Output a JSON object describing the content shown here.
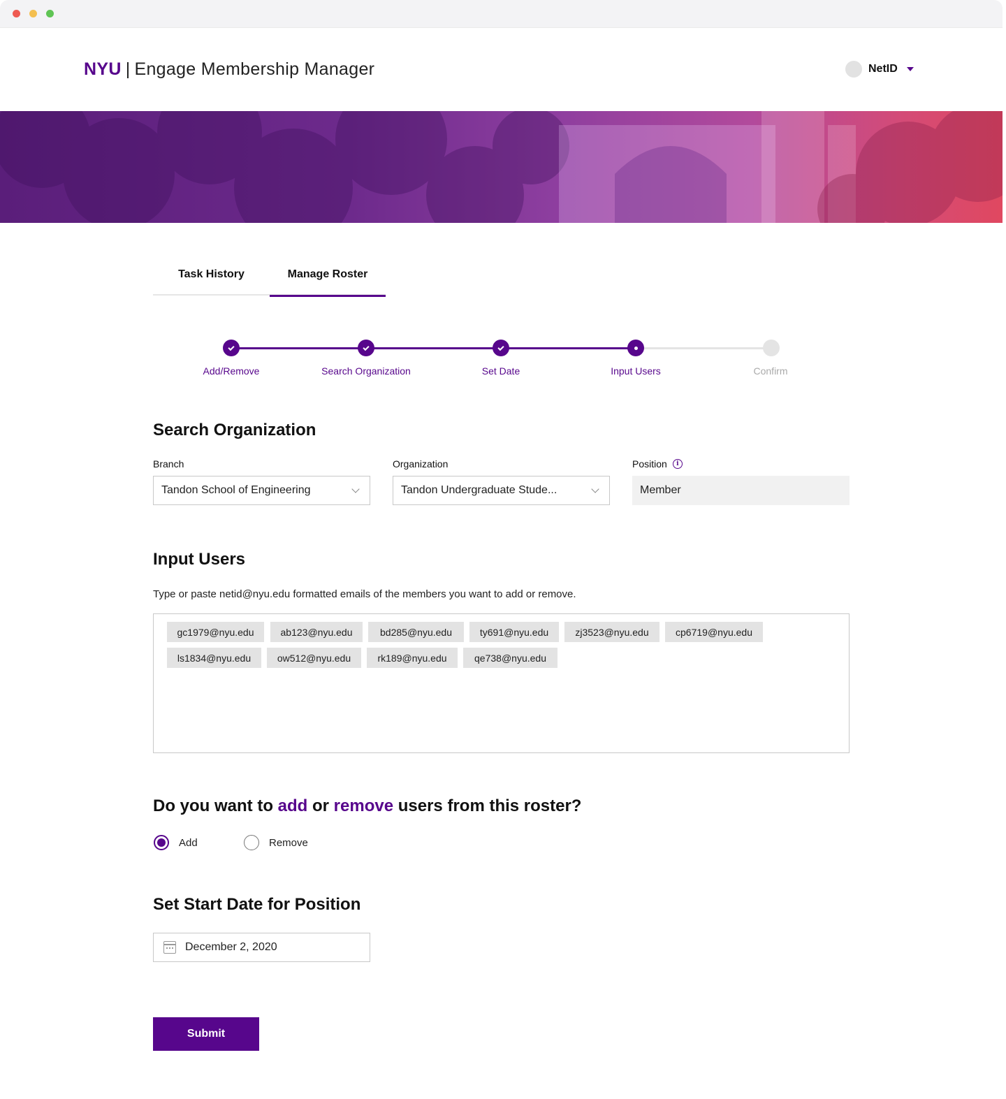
{
  "window": {
    "controls": [
      "close",
      "minimize",
      "maximize"
    ]
  },
  "header": {
    "brand_short": "NYU",
    "separator": "|",
    "app_title": "Engage Membership Manager",
    "user_label": "NetID",
    "brand_color": "#57068c"
  },
  "tabs": [
    {
      "label": "Task History",
      "active": false
    },
    {
      "label": "Manage Roster",
      "active": true
    }
  ],
  "stepper": {
    "steps": [
      {
        "label": "Add/Remove",
        "state": "done"
      },
      {
        "label": "Search Organization",
        "state": "done"
      },
      {
        "label": "Set Date",
        "state": "done"
      },
      {
        "label": "Input Users",
        "state": "current"
      },
      {
        "label": "Confirm",
        "state": "todo"
      }
    ]
  },
  "search_org": {
    "heading": "Search Organization",
    "branch_label": "Branch",
    "branch_value": "Tandon School of Engineering",
    "org_label": "Organization",
    "org_value": "Tandon Undergraduate Stude...",
    "position_label": "Position",
    "position_value": "Member"
  },
  "input_users": {
    "heading": "Input Users",
    "description": "Type or paste netid@nyu.edu formatted emails of the members you want to add or remove.",
    "emails": [
      "gc1979@nyu.edu",
      "ab123@nyu.edu",
      "bd285@nyu.edu",
      "ty691@nyu.edu",
      "zj3523@nyu.edu",
      "cp6719@nyu.edu",
      "ls1834@nyu.edu",
      "ow512@nyu.edu",
      "rk189@nyu.edu",
      "qe738@nyu.edu"
    ]
  },
  "action": {
    "q_prefix": "Do you want to",
    "q_add": "add",
    "q_or": "or",
    "q_remove": "remove",
    "q_suffix": "users from this roster?",
    "options": [
      {
        "label": "Add",
        "checked": true
      },
      {
        "label": "Remove",
        "checked": false
      }
    ]
  },
  "start_date": {
    "heading": "Set Start Date for Position",
    "value": "December 2, 2020"
  },
  "submit_label": "Submit"
}
